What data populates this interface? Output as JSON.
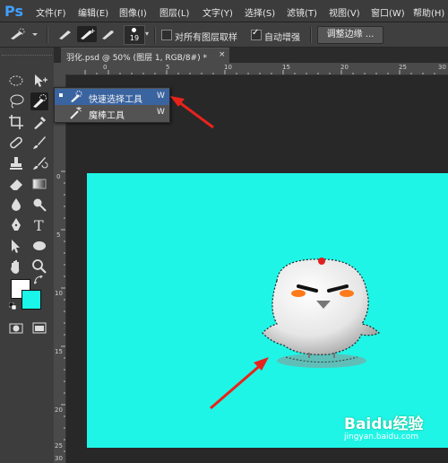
{
  "app": {
    "logo": "Ps"
  },
  "menu": [
    {
      "label": "文件(F)"
    },
    {
      "label": "编辑(E)"
    },
    {
      "label": "图像(I)"
    },
    {
      "label": "图层(L)"
    },
    {
      "label": "文字(Y)"
    },
    {
      "label": "选择(S)"
    },
    {
      "label": "滤镜(T)"
    },
    {
      "label": "视图(V)"
    },
    {
      "label": "窗口(W)"
    },
    {
      "label": "帮助(H)"
    }
  ],
  "options_bar": {
    "brush_size": "19",
    "sample_all_layers": {
      "label": "对所有图层取样",
      "checked": false
    },
    "auto_enhance": {
      "label": "自动增强",
      "checked": true
    },
    "refine_edge_label": "调整边缘 ..."
  },
  "document": {
    "tab_title": "羽化.psd @ 50% (图层 1, RGB/8#) *",
    "close_glyph": "×"
  },
  "ruler": {
    "top_ticks": [
      "0",
      "5",
      "10",
      "15",
      "20",
      "25",
      "30"
    ],
    "left_ticks": [
      "0",
      "5",
      "10",
      "15",
      "20",
      "25",
      "30"
    ]
  },
  "tool_flyout": {
    "items": [
      {
        "label": "快速选择工具",
        "shortcut": "W",
        "selected": true,
        "icon": "quick-selection-icon"
      },
      {
        "label": "魔棒工具",
        "shortcut": "W",
        "selected": false,
        "icon": "magic-wand-icon"
      }
    ]
  },
  "colors": {
    "foreground": "#ffffff",
    "background": "#19f5e8",
    "canvas_bg": "#1ff5e6",
    "annotation_arrow": "#e8231c",
    "accent": "#3fa0ff"
  },
  "watermark": {
    "brand": "Baidu经验",
    "url": "jingyan.baidu.com"
  }
}
